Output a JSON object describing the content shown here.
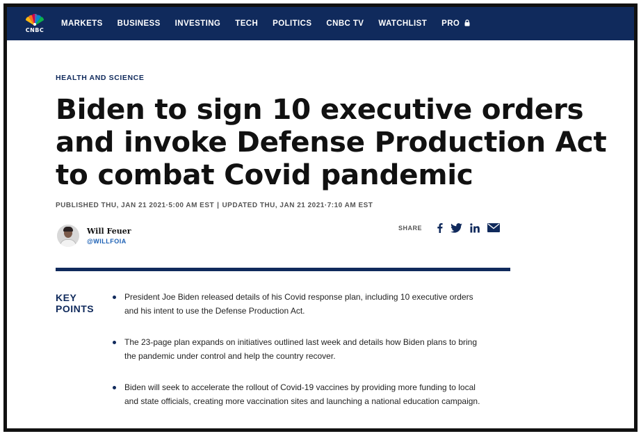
{
  "nav": {
    "logo_text": "CNBC",
    "items": [
      {
        "label": "MARKETS"
      },
      {
        "label": "BUSINESS"
      },
      {
        "label": "INVESTING"
      },
      {
        "label": "TECH"
      },
      {
        "label": "POLITICS"
      },
      {
        "label": "CNBC TV"
      },
      {
        "label": "WATCHLIST"
      },
      {
        "label": "PRO",
        "icon": "lock-icon"
      }
    ]
  },
  "article": {
    "section": "HEALTH AND SCIENCE",
    "headline": "Biden to sign 10 executive orders and invoke Defense Production Act to combat Covid pandemic",
    "published": "PUBLISHED THU, JAN 21 2021·5:00 AM EST",
    "separator": "|",
    "updated": "UPDATED THU, JAN 21 2021·7:10 AM EST",
    "author": {
      "name": "Will Feuer",
      "handle": "@WILLFOIA",
      "avatar_icon": "author-avatar"
    },
    "share": {
      "label": "SHARE",
      "icons": [
        "facebook-icon",
        "twitter-icon",
        "linkedin-icon",
        "email-icon"
      ]
    },
    "key_points": {
      "title_line1": "KEY",
      "title_line2": "POINTS",
      "items": [
        "President Joe Biden released details of his Covid response plan, including 10 executive orders and his intent to use the Defense Production Act.",
        "The 23-page plan expands on initiatives outlined last week and details how Biden plans to bring the pandemic under control and help the country recover.",
        "Biden will seek to accelerate the rollout of Covid-19 vaccines by providing more funding to local and state officials, creating more vaccination sites and launching a national education campaign."
      ]
    }
  },
  "colors": {
    "nav_bg": "#102a5c",
    "accent_blue": "#1a5fb4",
    "text": "#111111"
  }
}
